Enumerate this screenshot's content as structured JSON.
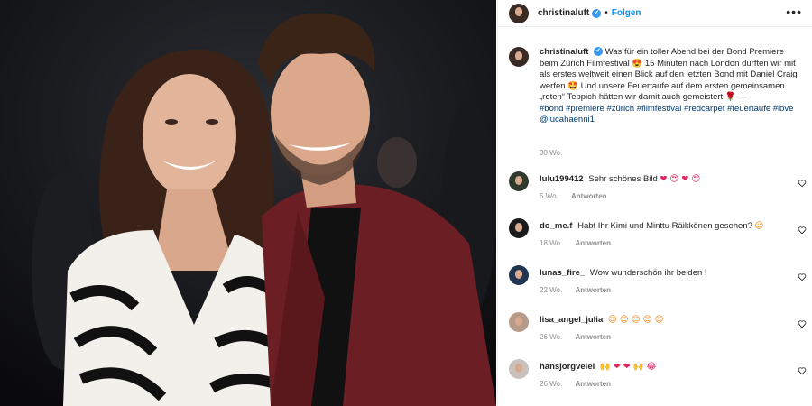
{
  "post": {
    "username": "christinaluft",
    "follow_label": "Folgen",
    "more_label": "•••",
    "verified_mark": "✔",
    "caption_text": "Was für ein toller Abend bei der Bond Premiere beim Zürich Filmfestival 😍 15 Minuten nach London durften wir mit als erstes weltweit einen Blick auf den letzten Bond mit Daniel Craig werfen 🤩 Und unsere Feuertaufe auf dem ersten gemeinsamen „roten“ Teppich hätten wir damit auch gemeistert 🌹 —",
    "hashtags": "#bond #premiere #zürich #filmfestival #redcarpet #feuertaufe #love @lucahaenni1",
    "age": "30 Wo."
  },
  "comments": [
    {
      "user": "lulu199412",
      "text": "Sehr schönes Bild",
      "emoji": "❤ 😍 ❤ 😍",
      "age": "5 Wo.",
      "reply": "Antworten",
      "avatar_color": "#2f3a2c"
    },
    {
      "user": "do_me.f",
      "text": "Habt Ihr Kimi und Minttu Räikkönen gesehen?",
      "emoji": "😉",
      "age": "18 Wo.",
      "reply": "Antworten",
      "avatar_color": "#1a1a1a"
    },
    {
      "user": "lunas_fire_",
      "text": "Wow wunderschön ihr beiden !",
      "emoji": "",
      "age": "22 Wo.",
      "reply": "Antworten",
      "avatar_color": "#20354f"
    },
    {
      "user": "lisa_angel_julia",
      "text": "",
      "emoji": "😍 😍 😍 😍 😍",
      "age": "26 Wo.",
      "reply": "Antworten",
      "avatar_color": "#b89a8a"
    },
    {
      "user": "hansjorgveiel",
      "text": "",
      "emoji": "🙌 ❤ ❤ 🙌 😂",
      "age": "26 Wo.",
      "reply": "Antworten",
      "avatar_color": "#c9c2bc"
    }
  ],
  "colors": {
    "link": "#0095f6",
    "hashtag": "#00376b",
    "muted": "#8e8e8e",
    "verified": "#3897f0"
  },
  "icons": {
    "like": "heart-outline-icon",
    "options": "more-options-icon"
  }
}
